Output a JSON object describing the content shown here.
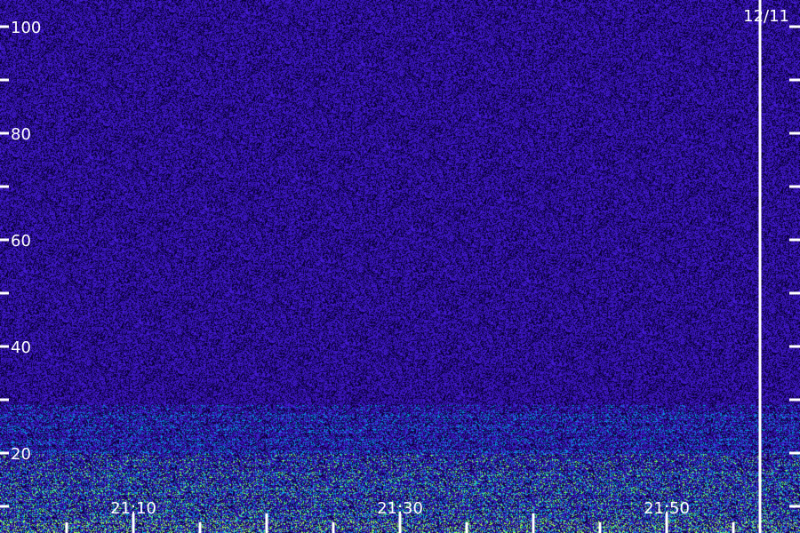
{
  "chart_data": {
    "type": "heatmap",
    "title": "",
    "xlabel": "",
    "ylabel": "",
    "date_label": "12/11",
    "x_tick_labels": [
      "21:10",
      "21:30",
      "21:50"
    ],
    "y_ticks": [
      20,
      40,
      60,
      80,
      100
    ],
    "ylim": [
      0,
      105
    ],
    "colors": {
      "background": "#000000",
      "noise_low": "#1a0a6e",
      "noise_mid": "#3a2bd0",
      "signal": "#00d8ff",
      "signal_strong": "#7dff5a",
      "axis": "#ffffff"
    },
    "grid": false,
    "legend": "none"
  }
}
